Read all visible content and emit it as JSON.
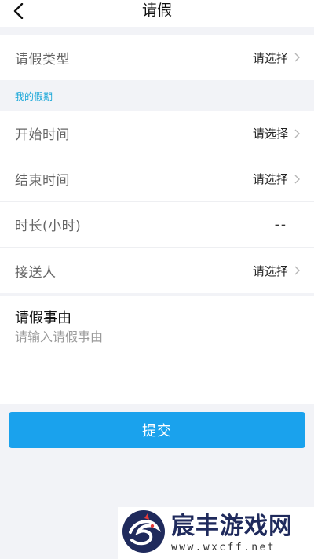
{
  "header": {
    "title": "请假"
  },
  "leave_type": {
    "label": "请假类型",
    "value": "请选择"
  },
  "section": {
    "label": "我的假期"
  },
  "fields": [
    {
      "label": "开始时间",
      "value": "请选择"
    },
    {
      "label": "结束时间",
      "value": "请选择"
    },
    {
      "label": "时长(小时)",
      "value": "--"
    },
    {
      "label": "接送人",
      "value": "请选择"
    }
  ],
  "reason": {
    "title": "请假事由",
    "placeholder": "请输入请假事由"
  },
  "submit": {
    "label": "提交"
  },
  "watermark": {
    "name": "宸丰游戏网",
    "url": "www.wxcff.net"
  },
  "colors": {
    "accent": "#1aa2ed",
    "section_label": "#1aa7d8",
    "background": "#f2f3f7"
  },
  "icons": {
    "back": "back-arrow-icon",
    "chevron": "chevron-right-icon"
  }
}
